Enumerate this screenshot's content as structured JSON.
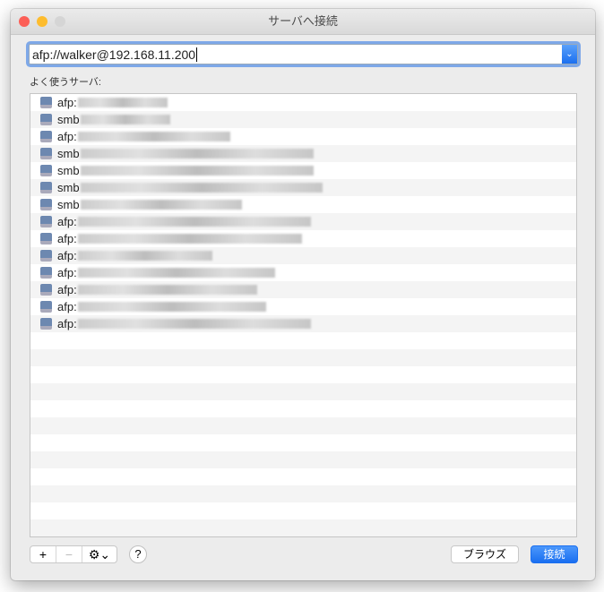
{
  "window": {
    "title": "サーバへ接続"
  },
  "address": {
    "value": "afp://walker@192.168.11.200"
  },
  "favorites_label": "よく使うサーバ:",
  "servers": [
    {
      "prefix": "afp:"
    },
    {
      "prefix": "smb"
    },
    {
      "prefix": "afp:"
    },
    {
      "prefix": "smb"
    },
    {
      "prefix": "smb"
    },
    {
      "prefix": "smb"
    },
    {
      "prefix": "smb"
    },
    {
      "prefix": "afp:"
    },
    {
      "prefix": "afp:"
    },
    {
      "prefix": "afp:"
    },
    {
      "prefix": "afp:"
    },
    {
      "prefix": "afp:"
    },
    {
      "prefix": "afp:"
    },
    {
      "prefix": "afp:"
    }
  ],
  "toolbar": {
    "add": "+",
    "remove": "−",
    "gear": "⚙⌄",
    "help": "?",
    "browse": "ブラウズ",
    "connect": "接続"
  },
  "colors": {
    "accent": "#1a73f0"
  }
}
